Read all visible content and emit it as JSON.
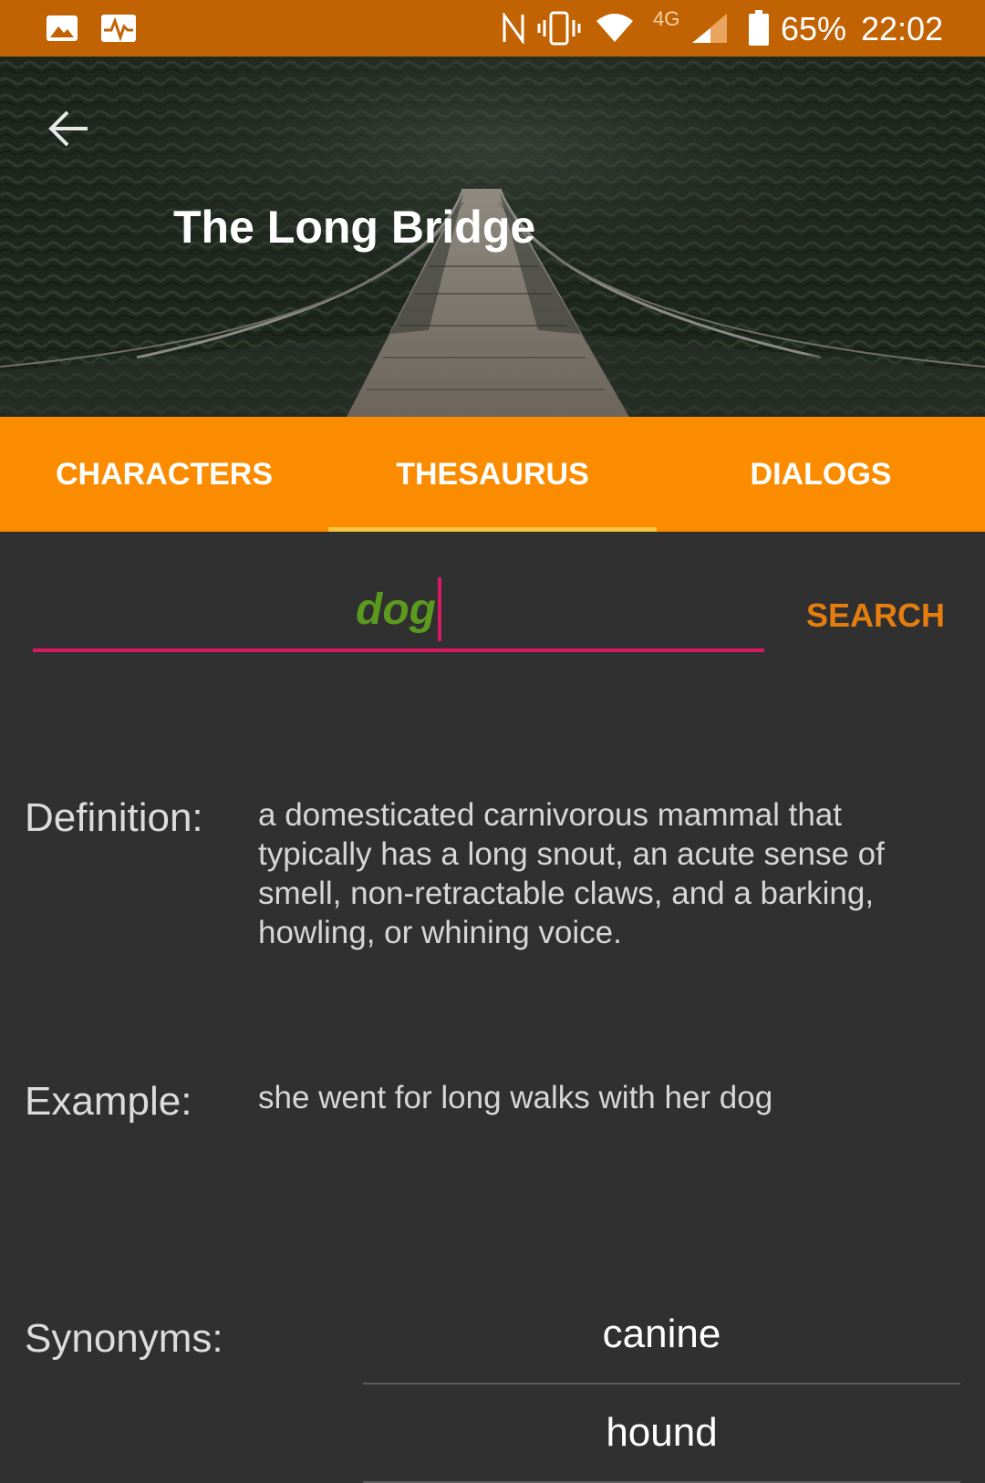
{
  "status_bar": {
    "battery": "65%",
    "time": "22:02",
    "network": "4G",
    "icons": [
      "image-icon",
      "activity-icon",
      "nfc-icon",
      "vibrate-icon",
      "wifi-icon",
      "signal-icon",
      "battery-icon"
    ]
  },
  "header": {
    "title": "The Long Bridge",
    "back_icon": "arrow-left-icon"
  },
  "tabs": [
    {
      "label": "CHARACTERS",
      "active": false
    },
    {
      "label": "THESAURUS",
      "active": true
    },
    {
      "label": "DIALOGS",
      "active": false
    }
  ],
  "search": {
    "value": "dog",
    "button_label": "SEARCH"
  },
  "definition": {
    "label": "Definition:",
    "text": "a domesticated carnivorous mammal that typically has a long snout, an acute sense of smell, non-retractable claws, and a barking, howling, or whining voice."
  },
  "example": {
    "label": "Example:",
    "text": "she went for long walks with her dog"
  },
  "synonyms": {
    "label": "Synonyms:",
    "items": [
      "canine",
      "hound"
    ]
  },
  "colors": {
    "status_bar": "#c26303",
    "tab_bar": "#fb8c00",
    "tab_indicator": "#f5c542",
    "background": "#303030",
    "search_underline": "#d81b60",
    "search_text": "#5b9a1e",
    "search_button": "#e67e0f"
  }
}
